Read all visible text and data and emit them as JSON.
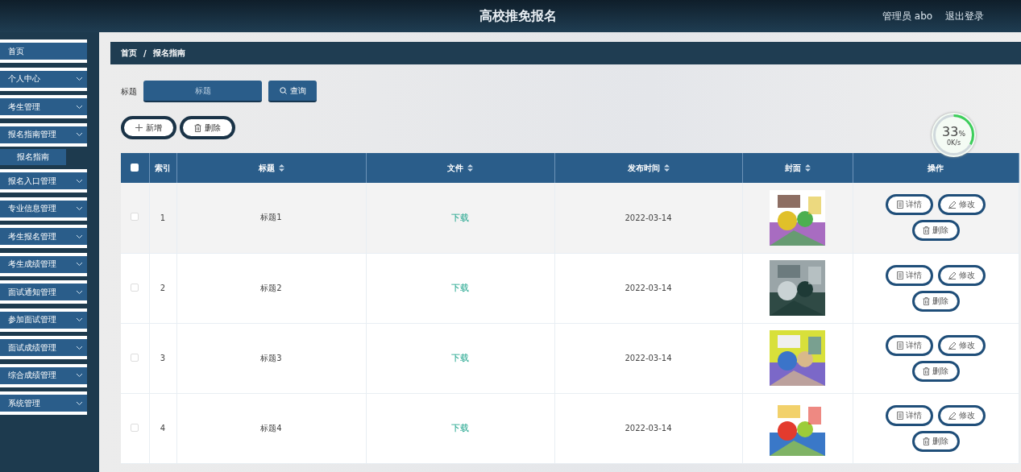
{
  "header": {
    "title": "高校推免报名",
    "user": "管理员 abo",
    "logout": "退出登录"
  },
  "sidebar": {
    "items": [
      {
        "label": "首页",
        "expandable": false
      },
      {
        "label": "个人中心",
        "expandable": true
      },
      {
        "label": "考生管理",
        "expandable": true
      },
      {
        "label": "报名指南管理",
        "expandable": true,
        "children": [
          {
            "label": "报名指南",
            "selected": true
          }
        ]
      },
      {
        "label": "报名入口管理",
        "expandable": true
      },
      {
        "label": "专业信息管理",
        "expandable": true
      },
      {
        "label": "考生报名管理",
        "expandable": true
      },
      {
        "label": "考生成绩管理",
        "expandable": true
      },
      {
        "label": "面试通知管理",
        "expandable": true
      },
      {
        "label": "参加面试管理",
        "expandable": true
      },
      {
        "label": "面试成绩管理",
        "expandable": true
      },
      {
        "label": "综合成绩管理",
        "expandable": true
      },
      {
        "label": "系统管理",
        "expandable": true
      }
    ]
  },
  "breadcrumb": [
    "首页",
    "/",
    "报名指南"
  ],
  "search": {
    "label": "标题",
    "placeholder": "标题",
    "button": "查询"
  },
  "actions": [
    {
      "kind": "add",
      "label": "新增"
    },
    {
      "kind": "delete",
      "label": "删除"
    }
  ],
  "table": {
    "columns": [
      {
        "label": "索引",
        "sortable": false
      },
      {
        "label": "标题",
        "sortable": true
      },
      {
        "label": "文件",
        "sortable": true
      },
      {
        "label": "发布时间",
        "sortable": true
      },
      {
        "label": "封面",
        "sortable": true
      },
      {
        "label": "操作",
        "sortable": false
      }
    ],
    "select_all": false,
    "rows": [
      {
        "index": "1",
        "title": "标题1",
        "file": "下载",
        "date": "2022-03-14",
        "cover": {
          "kind": "picture"
        },
        "highlighted": true,
        "checked": false,
        "actions": [
          {
            "kind": "detail",
            "label": "详情"
          },
          {
            "kind": "edit",
            "label": "修改"
          },
          {
            "kind": "delete",
            "label": "删除"
          }
        ]
      },
      {
        "index": "2",
        "title": "标题2",
        "file": "下载",
        "date": "2022-03-14",
        "cover": {
          "kind": "picture"
        },
        "highlighted": false,
        "checked": false,
        "actions": [
          {
            "kind": "detail",
            "label": "详情"
          },
          {
            "kind": "edit",
            "label": "修改"
          },
          {
            "kind": "delete",
            "label": "删除"
          }
        ]
      },
      {
        "index": "3",
        "title": "标题3",
        "file": "下载",
        "date": "2022-03-14",
        "cover": {
          "kind": "picture"
        },
        "highlighted": false,
        "checked": false,
        "actions": [
          {
            "kind": "detail",
            "label": "详情"
          },
          {
            "kind": "edit",
            "label": "修改"
          },
          {
            "kind": "delete",
            "label": "删除"
          }
        ]
      },
      {
        "index": "4",
        "title": "标题4",
        "file": "下载",
        "date": "2022-03-14",
        "cover": {
          "kind": "picture"
        },
        "highlighted": false,
        "checked": false,
        "actions": [
          {
            "kind": "detail",
            "label": "详情"
          },
          {
            "kind": "edit",
            "label": "修改"
          },
          {
            "kind": "delete",
            "label": "删除"
          }
        ]
      }
    ]
  },
  "speed_widget": {
    "percent": "33",
    "unit": "%",
    "speed": "0K/s",
    "level": 0.33
  }
}
